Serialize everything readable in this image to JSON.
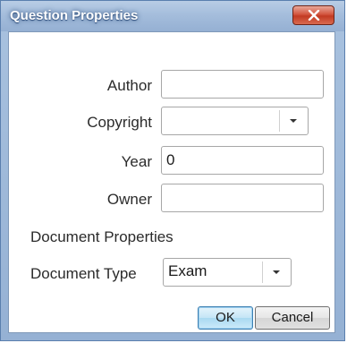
{
  "dialog": {
    "title": "Question Properties",
    "close_icon": "close-x-icon"
  },
  "fields": {
    "author": {
      "label": "Author",
      "value": ""
    },
    "copyright": {
      "label": "Copyright",
      "value": ""
    },
    "year": {
      "label": "Year",
      "value": "0"
    },
    "owner": {
      "label": "Owner",
      "value": ""
    }
  },
  "document": {
    "section_label": "Document Properties",
    "type_label": "Document Type",
    "type_value": "Exam"
  },
  "buttons": {
    "ok": "OK",
    "cancel": "Cancel"
  },
  "colors": {
    "title_bar": "#a3bcdb",
    "close_button": "#c23a22",
    "default_button": "#c4e5f6"
  }
}
